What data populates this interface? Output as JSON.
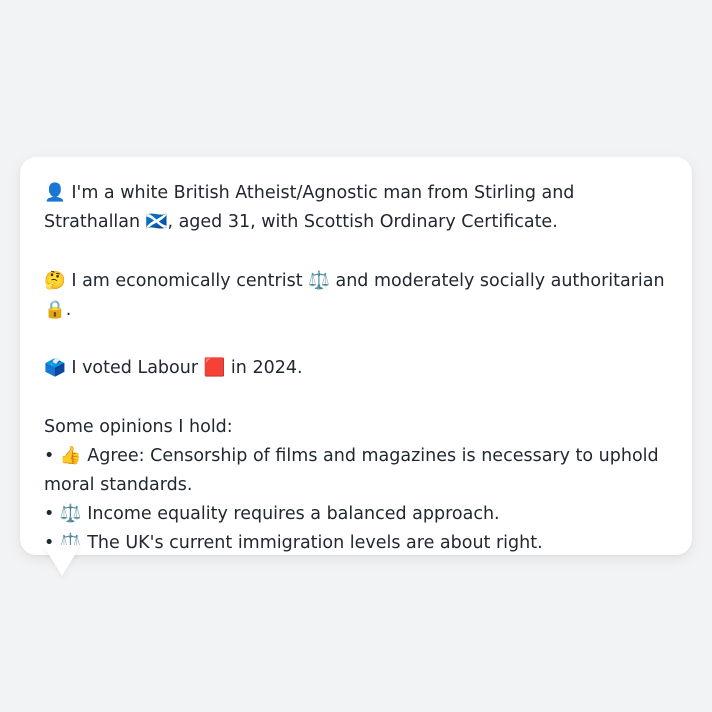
{
  "message": {
    "intro": "👤 I'm a white British Atheist/Agnostic man from Stirling and Strathallan 🏴󠁧󠁢󠁳󠁣󠁴󠁿, aged 31, with Scottish Ordinary Certificate.",
    "ideology": "🤔 I am economically centrist ⚖️ and moderately socially authoritarian 🔒.",
    "vote": "🗳️ I voted Labour 🟥 in 2024.",
    "opinions_heading": "Some opinions I hold:",
    "opinions": [
      "• 👍 Agree: Censorship of films and magazines is necessary to uphold moral standards.",
      "• ⚖️ Income equality requires a balanced approach.",
      "• ⚖️ The UK's current immigration levels are about right."
    ]
  },
  "colors": {
    "page_background": "#f2f3f5",
    "bubble_background": "#ffffff",
    "text": "#222831"
  }
}
